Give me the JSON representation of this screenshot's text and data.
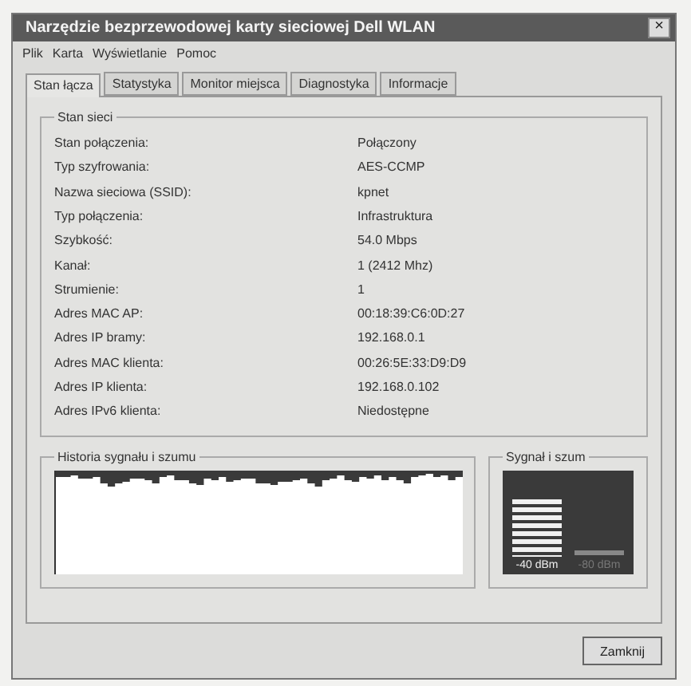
{
  "window": {
    "title": "Narzędzie bezprzewodowej karty sieciowej Dell WLAN",
    "close": "×"
  },
  "menu": [
    "Plik",
    "Karta",
    "Wyświetlanie",
    "Pomoc"
  ],
  "tabs": [
    {
      "label": "Stan łącza",
      "selected": true
    },
    {
      "label": "Statystyka",
      "selected": false
    },
    {
      "label": "Monitor miejsca",
      "selected": false
    },
    {
      "label": "Diagnostyka",
      "selected": false
    },
    {
      "label": "Informacje",
      "selected": false
    }
  ],
  "status_group": {
    "title": "Stan sieci",
    "rows": [
      {
        "label": "Stan połączenia:",
        "value": "Połączony"
      },
      {
        "label": "Typ szyfrowania:",
        "value": "AES-CCMP"
      },
      {
        "label": "Nazwa sieciowa (SSID):",
        "value": "kpnet"
      },
      {
        "label": "Typ połączenia:",
        "value": "Infrastruktura"
      },
      {
        "label": "Szybkość:",
        "value": "54.0 Mbps"
      },
      {
        "label": "Kanał:",
        "value": "1 (2412 Mhz)"
      },
      {
        "label": "Strumienie:",
        "value": "1"
      },
      {
        "label": "Adres MAC AP:",
        "value": "00:18:39:C6:0D:27"
      },
      {
        "label": "Adres IP bramy:",
        "value": "192.168.0.1"
      },
      {
        "label": "Adres MAC klienta:",
        "value": "00:26:5E:33:D9:D9"
      },
      {
        "label": "Adres IP klienta:",
        "value": "192.168.0.102"
      },
      {
        "label": "Adres IPv6 klienta:",
        "value": "Niedostępne"
      }
    ]
  },
  "history": {
    "title": "Historia sygnału i szumu"
  },
  "meter": {
    "title": "Sygnał i szum",
    "bars": [
      {
        "reading": "-40 dBm",
        "disabled": false
      },
      {
        "reading": "-80 dBm",
        "disabled": true
      }
    ]
  },
  "buttons": [
    "Zamknij"
  ]
}
